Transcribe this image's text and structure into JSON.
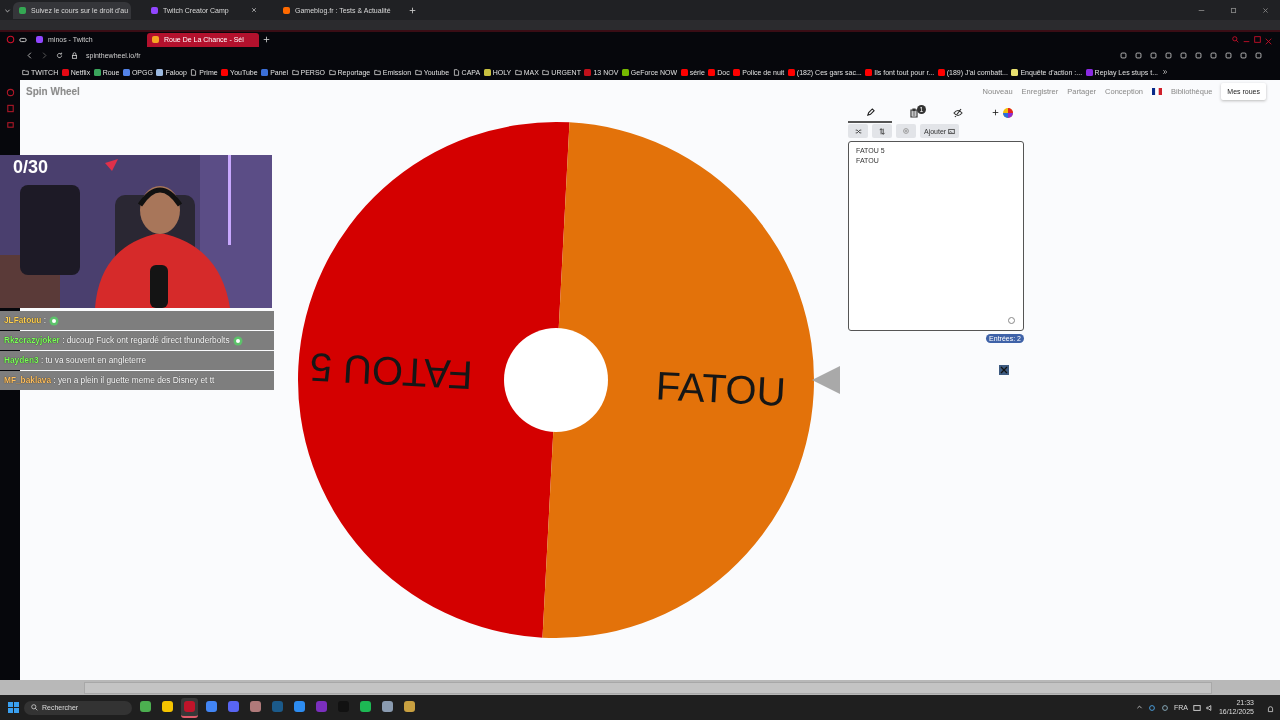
{
  "outer_tabs": [
    {
      "title": "Suivez le cours sur le droit d'au",
      "selected": true,
      "color": "#34a853"
    },
    {
      "title": "Twitch Creator Camp",
      "selected": false,
      "color": "#9146ff"
    },
    {
      "title": "Gameblog.fr : Tests & Actualité",
      "selected": false,
      "color": "#ff6a00"
    }
  ],
  "inner_tabs": [
    {
      "title": "minos - Twitch",
      "selected": false,
      "color": "#9146ff"
    },
    {
      "title": "Roue De La Chance - Sél",
      "selected": true,
      "color": "#f5a623"
    }
  ],
  "address": "spinthewheel.io/fr",
  "bookmarks": [
    {
      "label": "TWITCH",
      "kind": "folder"
    },
    {
      "label": "Netflix",
      "kind": "site",
      "color": "#e50914"
    },
    {
      "label": "Roue",
      "kind": "site",
      "color": "#3aa55c"
    },
    {
      "label": "OPGG",
      "kind": "site",
      "color": "#5383e8"
    },
    {
      "label": "Faloop",
      "kind": "site",
      "color": "#9ab8e0"
    },
    {
      "label": "Prime",
      "kind": "page"
    },
    {
      "label": "YouTube",
      "kind": "site",
      "color": "#ff0000"
    },
    {
      "label": "Panel",
      "kind": "site",
      "color": "#3b6fd8"
    },
    {
      "label": "PERSO",
      "kind": "folder"
    },
    {
      "label": "Reportage",
      "kind": "folder"
    },
    {
      "label": "Emission",
      "kind": "folder"
    },
    {
      "label": "Youtube",
      "kind": "folder"
    },
    {
      "label": "CAPA",
      "kind": "page"
    },
    {
      "label": "HOLY",
      "kind": "site",
      "color": "#c8c040"
    },
    {
      "label": "MAX",
      "kind": "folder"
    },
    {
      "label": "URGENT",
      "kind": "folder"
    },
    {
      "label": "13 NOV",
      "kind": "site",
      "color": "#c0101a"
    },
    {
      "label": "GeForce NOW",
      "kind": "site",
      "color": "#76b900"
    },
    {
      "label": "série",
      "kind": "site",
      "color": "#ff0000"
    },
    {
      "label": "Doc",
      "kind": "site",
      "color": "#ff0000"
    },
    {
      "label": "Police de nuit",
      "kind": "site",
      "color": "#ff0000"
    },
    {
      "label": "(182) Ces gars sac...",
      "kind": "site",
      "color": "#ff0000"
    },
    {
      "label": "Ils font tout pour r...",
      "kind": "site",
      "color": "#ff0000"
    },
    {
      "label": "(189) J'ai combatt...",
      "kind": "site",
      "color": "#ff0000"
    },
    {
      "label": "Enquête d'action :...",
      "kind": "site",
      "color": "#e8e070"
    },
    {
      "label": "Replay Les stups t...",
      "kind": "site",
      "color": "#8a2be2"
    }
  ],
  "page": {
    "logo": "Spin Wheel",
    "nav": [
      "Nouveau",
      "Enregistrer",
      "Partager",
      "Conception",
      "Bibliothèque"
    ],
    "account_button": "Mes roues"
  },
  "wheel": {
    "segments": [
      {
        "label": "FATOU 5",
        "color": "#d40000"
      },
      {
        "label": "FATOU",
        "color": "#e3720a"
      }
    ]
  },
  "editor": {
    "tabs": [
      {
        "kind": "edit",
        "selected": true
      },
      {
        "kind": "results",
        "selected": false,
        "badge": "1"
      },
      {
        "kind": "hidden",
        "selected": false
      },
      {
        "kind": "colors",
        "selected": false
      }
    ],
    "tools": [
      {
        "kind": "shuffle"
      },
      {
        "kind": "sort"
      },
      {
        "kind": "settings"
      },
      {
        "kind": "add",
        "label": "Ajouter"
      }
    ],
    "entries": [
      "FATOU 5",
      "FATOU"
    ],
    "count": "Entrées: 2"
  },
  "stream": {
    "counter": "0/30",
    "chat": [
      {
        "user": "JLFatouu",
        "color": "#ffd050",
        "text": ":",
        "emote": true
      },
      {
        "user": "Rkzcrazyjoker",
        "color": "#7dff5a",
        "text": ": ducoup Fuck ont regardé direct thunderbolts",
        "emote": true
      },
      {
        "user": "Hayden3",
        "color": "#7dff5a",
        "text": ": tu va souvent en angleterre",
        "emote": false
      },
      {
        "user": "MF_baklava",
        "color": "#ffc060",
        "text": ": yen a plein il guette meme des Disney et tt",
        "emote": false
      }
    ]
  },
  "taskbar": {
    "search": {
      "placeholder": "Rechercher"
    },
    "apps": [
      {
        "color": "#4caf50",
        "selected": false
      },
      {
        "color": "#f5c400",
        "selected": false
      },
      {
        "color": "#c0142a",
        "selected": true
      },
      {
        "color": "#4285f4",
        "selected": false
      },
      {
        "color": "#5865f2",
        "selected": false
      },
      {
        "color": "#b07a7a",
        "selected": false
      },
      {
        "color": "#1b5a8a",
        "selected": false
      },
      {
        "color": "#2d8cf0",
        "selected": false
      },
      {
        "color": "#7b2fbe",
        "selected": false
      },
      {
        "color": "#111111",
        "selected": false
      },
      {
        "color": "#1db954",
        "selected": false
      },
      {
        "color": "#8a9bb0",
        "selected": false
      },
      {
        "color": "#c8a040",
        "selected": false
      }
    ],
    "language": "FRA",
    "time": "21:33",
    "date": "16/12/2025"
  }
}
